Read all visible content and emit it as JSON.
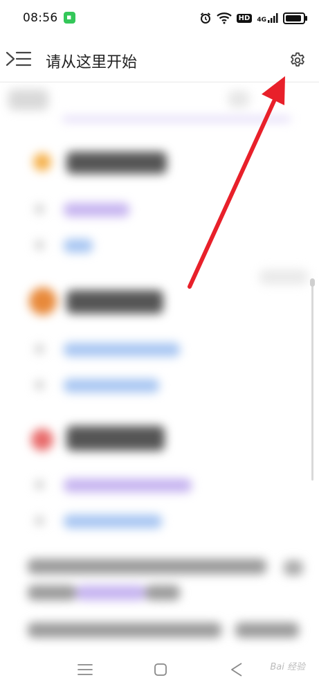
{
  "status_bar": {
    "time": "08:56",
    "icons": [
      "alarm-icon",
      "wifi-icon",
      "hd-badge",
      "4g-signal-icon",
      "battery-icon"
    ],
    "hd_label": "HD",
    "network_label": "4G"
  },
  "header": {
    "title": "请从这里开始",
    "menu_icon": "menu-expand-icon",
    "settings_icon": "gear-icon"
  },
  "annotation": {
    "color": "#e8202a",
    "points_to": "settings-button"
  },
  "navigation": {
    "items": [
      "menu-nav-icon",
      "home-nav-icon",
      "back-nav-icon"
    ]
  },
  "watermark": {
    "text": "Bai 经验"
  }
}
